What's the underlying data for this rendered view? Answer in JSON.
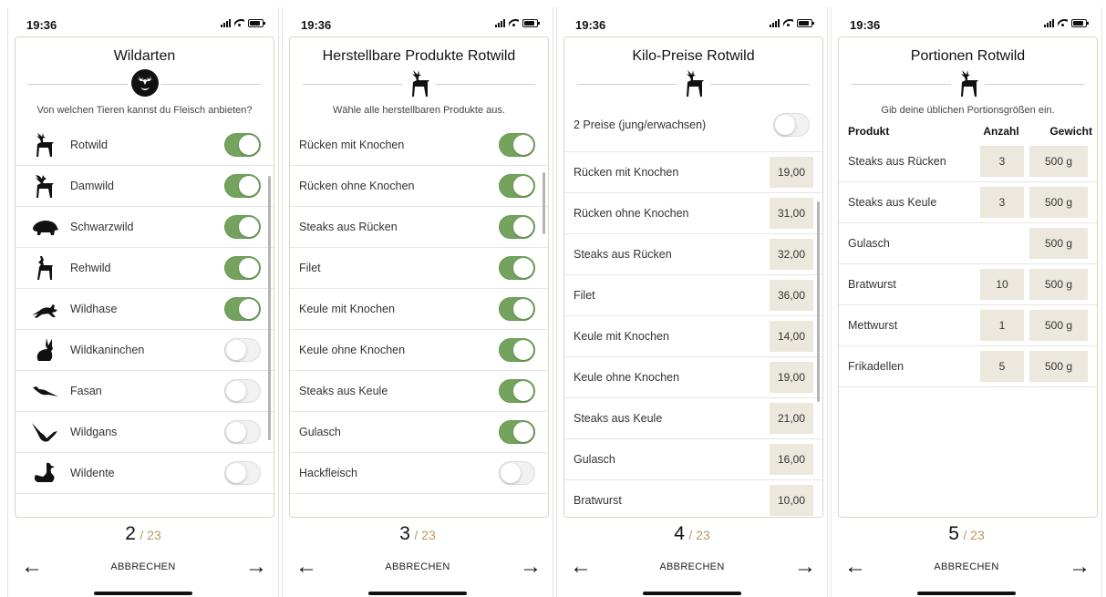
{
  "status": {
    "time": "19:36"
  },
  "footer": {
    "cancel_label": "ABBRECHEN",
    "back_arrow": "←",
    "forward_arrow": "→",
    "total": "/ 23"
  },
  "screens": [
    {
      "title": "Wildarten",
      "page": "2",
      "subtitle": "Von welchen Tieren kannst du Fleisch anbieten?",
      "items": [
        {
          "label": "Rotwild",
          "on": true,
          "icon": "deer-icon"
        },
        {
          "label": "Damwild",
          "on": true,
          "icon": "fallow-deer-icon"
        },
        {
          "label": "Schwarzwild",
          "on": true,
          "icon": "boar-icon"
        },
        {
          "label": "Rehwild",
          "on": true,
          "icon": "roe-deer-icon"
        },
        {
          "label": "Wildhase",
          "on": true,
          "icon": "hare-icon"
        },
        {
          "label": "Wildkaninchen",
          "on": false,
          "icon": "rabbit-icon"
        },
        {
          "label": "Fasan",
          "on": false,
          "icon": "pheasant-icon"
        },
        {
          "label": "Wildgans",
          "on": false,
          "icon": "goose-icon"
        },
        {
          "label": "Wildente",
          "on": false,
          "icon": "duck-icon"
        }
      ]
    },
    {
      "title": "Herstellbare Produkte Rotwild",
      "page": "3",
      "subtitle": "Wähle alle herstellbaren Produkte aus.",
      "items": [
        {
          "label": "Rücken mit Knochen",
          "on": true
        },
        {
          "label": "Rücken ohne Knochen",
          "on": true
        },
        {
          "label": "Steaks aus Rücken",
          "on": true
        },
        {
          "label": "Filet",
          "on": true
        },
        {
          "label": "Keule mit Knochen",
          "on": true
        },
        {
          "label": "Keule ohne Knochen",
          "on": true
        },
        {
          "label": "Steaks aus Keule",
          "on": true
        },
        {
          "label": "Gulasch",
          "on": true
        },
        {
          "label": "Hackfleisch",
          "on": false
        }
      ]
    },
    {
      "title": "Kilo-Preise Rotwild",
      "page": "4",
      "two_prices_label": "2 Preise (jung/erwachsen)",
      "two_prices_on": false,
      "items": [
        {
          "label": "Rücken mit Knochen",
          "price": "19,00"
        },
        {
          "label": "Rücken ohne Knochen",
          "price": "31,00"
        },
        {
          "label": "Steaks aus Rücken",
          "price": "32,00"
        },
        {
          "label": "Filet",
          "price": "36,00"
        },
        {
          "label": "Keule mit Knochen",
          "price": "14,00"
        },
        {
          "label": "Keule ohne Knochen",
          "price": "19,00"
        },
        {
          "label": "Steaks aus Keule",
          "price": "21,00"
        },
        {
          "label": "Gulasch",
          "price": "16,00"
        },
        {
          "label": "Bratwurst",
          "price": "10,00"
        }
      ]
    },
    {
      "title": "Portionen Rotwild",
      "page": "5",
      "subtitle": "Gib deine üblichen Portionsgrößen ein.",
      "headers": {
        "product": "Produkt",
        "count": "Anzahl",
        "weight": "Gewicht"
      },
      "items": [
        {
          "label": "Steaks aus Rücken",
          "count": "3",
          "weight": "500 g"
        },
        {
          "label": "Steaks aus Keule",
          "count": "3",
          "weight": "500 g"
        },
        {
          "label": "Gulasch",
          "count": "",
          "weight": "500 g"
        },
        {
          "label": "Bratwurst",
          "count": "10",
          "weight": "500 g"
        },
        {
          "label": "Mettwurst",
          "count": "1",
          "weight": "500 g"
        },
        {
          "label": "Frikadellen",
          "count": "5",
          "weight": "500 g"
        }
      ]
    }
  ],
  "colors": {
    "toggle_on": "#73a35d",
    "toggle_off": "#f1f1f1",
    "input_bg": "#ede8dd",
    "pager_total": "#b89a63"
  }
}
